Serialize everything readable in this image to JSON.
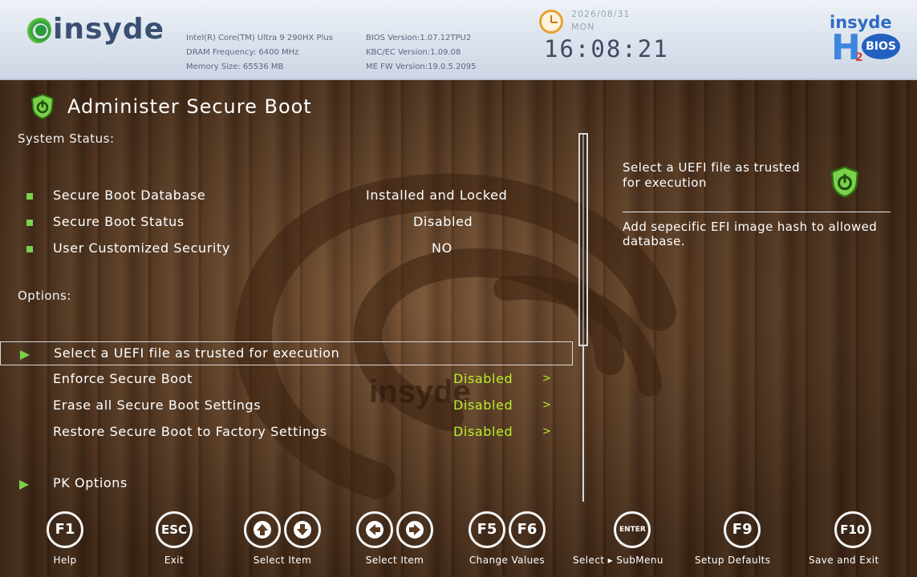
{
  "header": {
    "brand": "insyde",
    "sysinfo_col1": [
      "Intel(R) Core(TM) Ultra 9 290HX Plus",
      "DRAM Frequency: 6400 MHz",
      "Memory Size: 65536 MB"
    ],
    "sysinfo_col2": [
      "BIOS Version:1.07.12TPU2",
      "KBC/EC Version:1.09.08",
      "ME FW Version:19.0.5.2095"
    ],
    "date": "2026/08/31",
    "day": "MON",
    "time": "16:08:21",
    "h2_brand": "insyde",
    "h2_letter": "H",
    "h2_sub": "2",
    "h2_bios": "BIOS"
  },
  "page": {
    "title": "Administer Secure Boot",
    "system_status_heading": "System Status:",
    "options_heading": "Options:"
  },
  "status_items": [
    {
      "label": "Secure Boot Database",
      "value": "Installed and Locked"
    },
    {
      "label": "Secure Boot Status",
      "value": "Disabled"
    },
    {
      "label": "User Customized Security",
      "value": "NO"
    }
  ],
  "options": {
    "selected": "Select a UEFI file as trusted for execution",
    "items": [
      {
        "label": "Enforce Secure Boot",
        "value": "Disabled",
        "chevron": ">"
      },
      {
        "label": "Erase all Secure Boot Settings",
        "value": "Disabled",
        "chevron": ">"
      },
      {
        "label": "Restore Secure Boot to Factory Settings",
        "value": "Disabled",
        "chevron": ">"
      }
    ],
    "pk_options": "PK Options"
  },
  "help": {
    "title": "Select a UEFI file as trusted for execution",
    "description": "Add sepecific EFI image hash to allowed database."
  },
  "keys": [
    {
      "keys": [
        "F1"
      ],
      "label": "Help"
    },
    {
      "keys": [
        "ESC"
      ],
      "label": "Exit"
    },
    {
      "keys": [
        "up",
        "down"
      ],
      "label": "Select Item"
    },
    {
      "keys": [
        "left",
        "right"
      ],
      "label": "Select Item"
    },
    {
      "keys": [
        "F5",
        "F6"
      ],
      "label": "Change Values"
    },
    {
      "keys": [
        "ENTER"
      ],
      "label": "Select ▸ SubMenu"
    },
    {
      "keys": [
        "F9"
      ],
      "label": "Setup Defaults"
    },
    {
      "keys": [
        "F10"
      ],
      "label": "Save and Exit"
    }
  ],
  "colors": {
    "accent_green": "#7ad14a",
    "value_green": "#b9f02a",
    "header_bg": "#dfe6ef"
  }
}
